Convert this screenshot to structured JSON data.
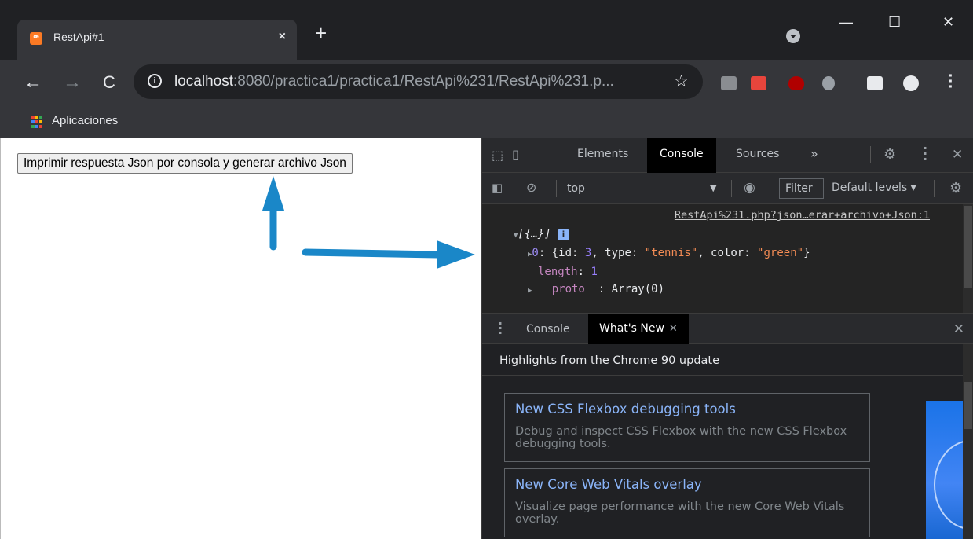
{
  "browser": {
    "tab_title": "RestApi#1",
    "tab_close": "×",
    "new_tab": "+",
    "favicon": "xampp-icon",
    "url_host": "localhost",
    "url_rest": ":8080/practica1/practica1/RestApi%231/RestApi%231.p...",
    "bookmark_apps": "Aplicaciones",
    "window_minimize": "—",
    "window_maximize": "☐",
    "window_close": "✕",
    "extensions": [
      {
        "name": "css-viewer-extension-icon",
        "color": "#8a8d91"
      },
      {
        "name": "gift-extension-icon",
        "color": "#e8453c"
      },
      {
        "name": "ublock-origin-icon",
        "color": "#b00000"
      },
      {
        "name": "share-extension-icon",
        "color": "#9aa0a6"
      },
      {
        "name": "puzzle-extensions-icon",
        "color": "#e8eaed"
      },
      {
        "name": "profile-icon",
        "color": "#e8eaed"
      }
    ],
    "apps_colors": [
      "#ea4335",
      "#fbbc04",
      "#34a853",
      "#4285f4",
      "#ea4335",
      "#fbbc04",
      "#34a853",
      "#4285f4",
      "#ea4335"
    ]
  },
  "page": {
    "button_label": "Imprimir respuesta Json por consola y generar archivo Json",
    "arrow_color": "#1a87c8"
  },
  "devtools": {
    "tabs": [
      "Elements",
      "Console",
      "Sources"
    ],
    "active_tab": "Console",
    "more_tabs": "»",
    "context": "top",
    "filter_label": "Filter",
    "levels_label": "Default levels ▾",
    "console": {
      "source_link": "RestApi%231.php?json…erar+archivo+Json:1",
      "array_summary": "[{…}]",
      "item_index": "0",
      "item_id": "3",
      "item_type": "\"tennis\"",
      "item_color": "\"green\"",
      "length_key": "length",
      "length_value": "1",
      "proto_key": "__proto__",
      "proto_value": "Array(0)"
    },
    "drawer_tabs": [
      "Console",
      "What's New"
    ],
    "whats_new": {
      "heading": "Highlights from the Chrome 90 update",
      "cards": [
        {
          "title": "New CSS Flexbox debugging tools",
          "desc": "Debug and inspect CSS Flexbox with the new CSS Flexbox debugging tools."
        },
        {
          "title": "New Core Web Vitals overlay",
          "desc": "Visualize page performance with the new Core Web Vitals overlay."
        }
      ]
    }
  }
}
